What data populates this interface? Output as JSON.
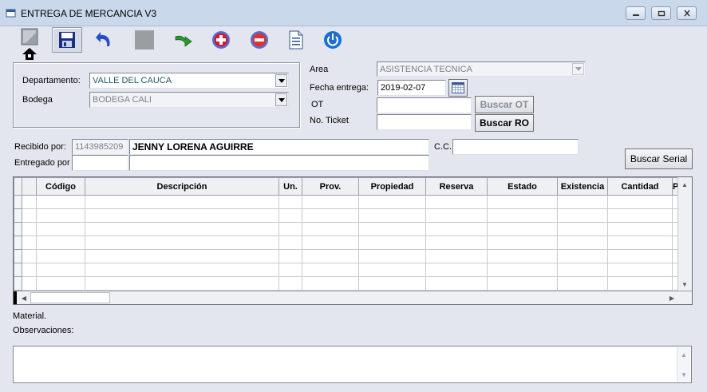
{
  "window": {
    "title": "ENTREGA DE MERCANCIA V3",
    "controls": {
      "minimize": "minimize-icon",
      "maximize": "maximize-icon",
      "close": "close-icon"
    }
  },
  "toolbar": {
    "icons": [
      "new-document-icon",
      "save-icon",
      "undo-icon",
      "stop-icon",
      "export-icon",
      "add-icon",
      "remove-icon",
      "report-icon",
      "power-icon"
    ],
    "colors": {
      "save": "#1a2f8a",
      "undo": "#1f4fd0",
      "add": "#d8182a",
      "remove": "#e03030",
      "power": "#1a6fd6",
      "export": "#2c9a2c"
    }
  },
  "form": {
    "departamento_label": "Departamento:",
    "departamento_value": "VALLE DEL CAUCA",
    "bodega_label": "Bodega",
    "bodega_value": "BODEGA CALI",
    "area_label": "Area",
    "area_value": "ASISTENCIA TECNICA",
    "fecha_label": "Fecha entrega:",
    "fecha_value": "2019-02-07",
    "ot_label": "OT",
    "ot_value": "",
    "ticket_label": "No. Ticket",
    "ticket_value": "",
    "buscar_ot": "Buscar OT",
    "buscar_ro": "Buscar RO",
    "recibido_label": "Recibido por:",
    "recibido_id": "1143985209",
    "recibido_name": "JENNY LORENA AGUIRRE",
    "cc_label": "C.C.",
    "cc_value": "",
    "entregado_label": "Entregado por",
    "entregado_id": "",
    "entregado_name": "",
    "buscar_serial": "Buscar Serial"
  },
  "grid": {
    "columns": [
      "Código",
      "Descripción",
      "Un.",
      "Prov.",
      "Propiedad",
      "Reserva",
      "Estado",
      "Existencia",
      "Cantidad",
      "P"
    ],
    "rows": [
      [
        "",
        "",
        "",
        "",
        "",
        "",
        "",
        "",
        "",
        ""
      ],
      [
        "",
        "",
        "",
        "",
        "",
        "",
        "",
        "",
        "",
        ""
      ],
      [
        "",
        "",
        "",
        "",
        "",
        "",
        "",
        "",
        "",
        ""
      ],
      [
        "",
        "",
        "",
        "",
        "",
        "",
        "",
        "",
        "",
        ""
      ],
      [
        "",
        "",
        "",
        "",
        "",
        "",
        "",
        "",
        "",
        ""
      ],
      [
        "",
        "",
        "",
        "",
        "",
        "",
        "",
        "",
        "",
        ""
      ],
      [
        "",
        "",
        "",
        "",
        "",
        "",
        "",
        "",
        "",
        ""
      ]
    ]
  },
  "material_label": "Material.",
  "observaciones_label": "Observaciones:",
  "observaciones_value": ""
}
